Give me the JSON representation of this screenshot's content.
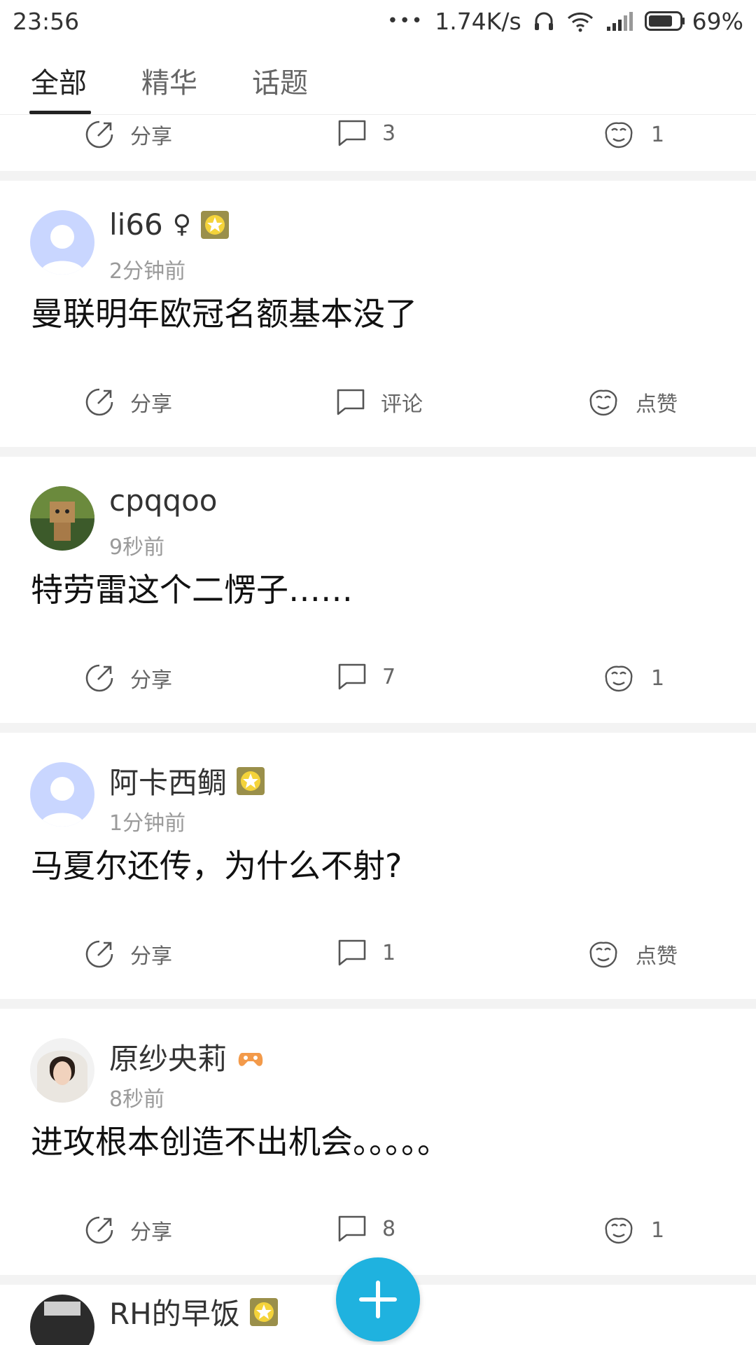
{
  "status_bar": {
    "time": "23:56",
    "dots": "•••",
    "speed": "1.74K/s",
    "battery": "69%"
  },
  "tabs": [
    {
      "label": "全部",
      "active": true
    },
    {
      "label": "精华",
      "active": false
    },
    {
      "label": "话题",
      "active": false
    }
  ],
  "partial_post": {
    "share": "分享",
    "comments": "3",
    "likes": "1"
  },
  "posts": [
    {
      "username": "li66",
      "gender": "♀",
      "badge": "gold-star-badge-icon",
      "time": "2分钟前",
      "text": "曼联明年欧冠名额基本没了",
      "share": "分享",
      "comments": "评论",
      "likes": "点赞"
    },
    {
      "username": "cpqqoo",
      "time": "9秒前",
      "text": "特劳雷这个二愣子……",
      "share": "分享",
      "comments": "7",
      "likes": "1"
    },
    {
      "username": "阿卡西鲷",
      "badge": "gold-star-badge-icon",
      "time": "1分钟前",
      "text": "马夏尔还传，为什么不射?",
      "share": "分享",
      "comments": "1",
      "likes": "点赞"
    },
    {
      "username": "原纱央莉",
      "badge": "gamepad-badge-icon",
      "time": "8秒前",
      "text": "进攻根本创造不出机会。。。。。",
      "share": "分享",
      "comments": "8",
      "likes": "1"
    }
  ],
  "next_post": {
    "username": "RH的早饭"
  },
  "colors": {
    "accent": "#1fb2df",
    "separator": "#f3f3f3",
    "text_primary": "#111111",
    "text_secondary": "#9a9a9a"
  },
  "fab": {
    "icon": "plus-icon"
  }
}
